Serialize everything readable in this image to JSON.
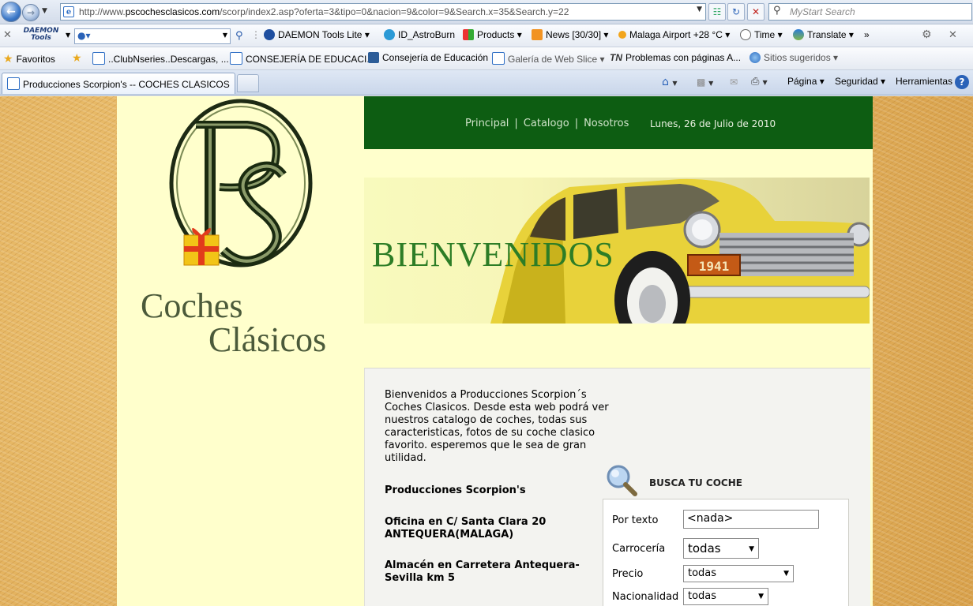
{
  "browser": {
    "url_prefix": "http://www.",
    "url_domain": "pscochesclasicos.com",
    "url_path": "/scorp/index2.asp?oferta=3&tipo=0&nacion=9&color=9&Search.x=35&Search.y=22",
    "search_placeholder": "MyStart Search",
    "toolbar": {
      "daemon_logo": "DAEMON Tools",
      "daemon_lite": "DAEMON Tools Lite",
      "astroburn": "ID_AstroBurn",
      "products": "Products",
      "news": "News [30/30]",
      "weather": "Malaga Airport +28 °C",
      "time": "Time",
      "translate": "Translate",
      "more": "»"
    },
    "favorites": {
      "label": "Favoritos",
      "items": [
        "..ClubNseries..Descargas, ...",
        "CONSEJERÍA DE EDUCACI...",
        "Consejería de Educación",
        "Galería de Web Slice",
        "Problemas con páginas A...",
        "Sitios sugeridos"
      ]
    },
    "tab_title": "Producciones Scorpion's -- COCHES CLASICOS",
    "commands": {
      "pagina": "Página",
      "seguridad": "Seguridad",
      "herramientas": "Herramientas"
    }
  },
  "site": {
    "logo_text_line1": "Coches",
    "logo_text_line2": "Clásicos",
    "nav": [
      "Principal",
      "Catalogo",
      "Nosotros"
    ],
    "date": "Lunes, 26 de Julio de 2010",
    "banner_text": "BIENVENIDOS",
    "plate_text": "1941",
    "intro": "Bienvenidos a Producciones Scorpion´s Coches Clasicos. Desde esta web podrá ver nuestros catalogo de coches, todas sus caracteristicas, fotos de su coche clasico favorito. esperemos que le sea de gran utilidad.",
    "company": "Producciones Scorpion's",
    "office": "Oficina en C/ Santa Clara 20 ANTEQUERA(MALAGA)",
    "warehouse": "Almacén en Carretera Antequera-Sevilla km 5",
    "search": {
      "title": "BUSCA TU COCHE",
      "por_texto_label": "Por texto",
      "por_texto_value": "<nada>",
      "carroceria_label": "Carrocería",
      "carroceria_value": "todas",
      "precio_label": "Precio",
      "precio_value": "todas",
      "nacionalidad_label": "Nacionalidad",
      "nacionalidad_value": "todas"
    }
  }
}
